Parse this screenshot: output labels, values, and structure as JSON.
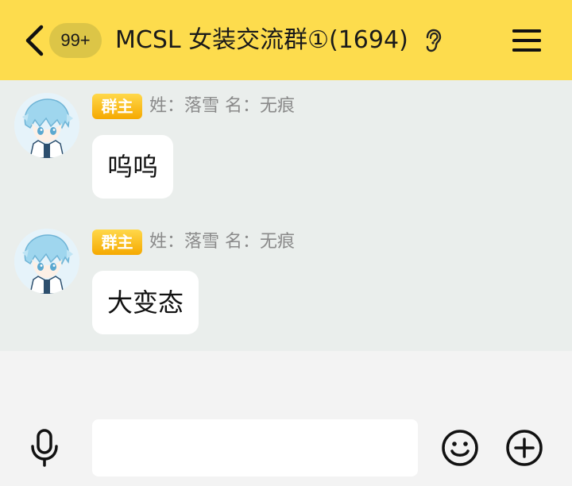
{
  "header": {
    "unread_count": "99+",
    "title": "MCSL 女装交流群①(1694)",
    "icons": {
      "back": "chevron-left-icon",
      "listen": "ear-icon",
      "menu": "hamburger-menu-icon"
    },
    "background_color": "#fddc4d"
  },
  "messages": [
    {
      "role_badge": "群主",
      "sender": "姓：落雪 名：无痕",
      "text": "呜呜",
      "avatar": "anime-avatar"
    },
    {
      "role_badge": "群主",
      "sender": "姓：落雪 名：无痕",
      "text": "大变态",
      "avatar": "anime-avatar"
    }
  ],
  "input_bar": {
    "value": "",
    "placeholder": "",
    "icons": {
      "voice": "microphone-icon",
      "emoji": "smiley-icon",
      "more": "plus-circle-icon"
    }
  },
  "colors": {
    "accent": "#fddc4d",
    "chat_background": "#eaeeec",
    "badge_gold": "#f5a900"
  }
}
